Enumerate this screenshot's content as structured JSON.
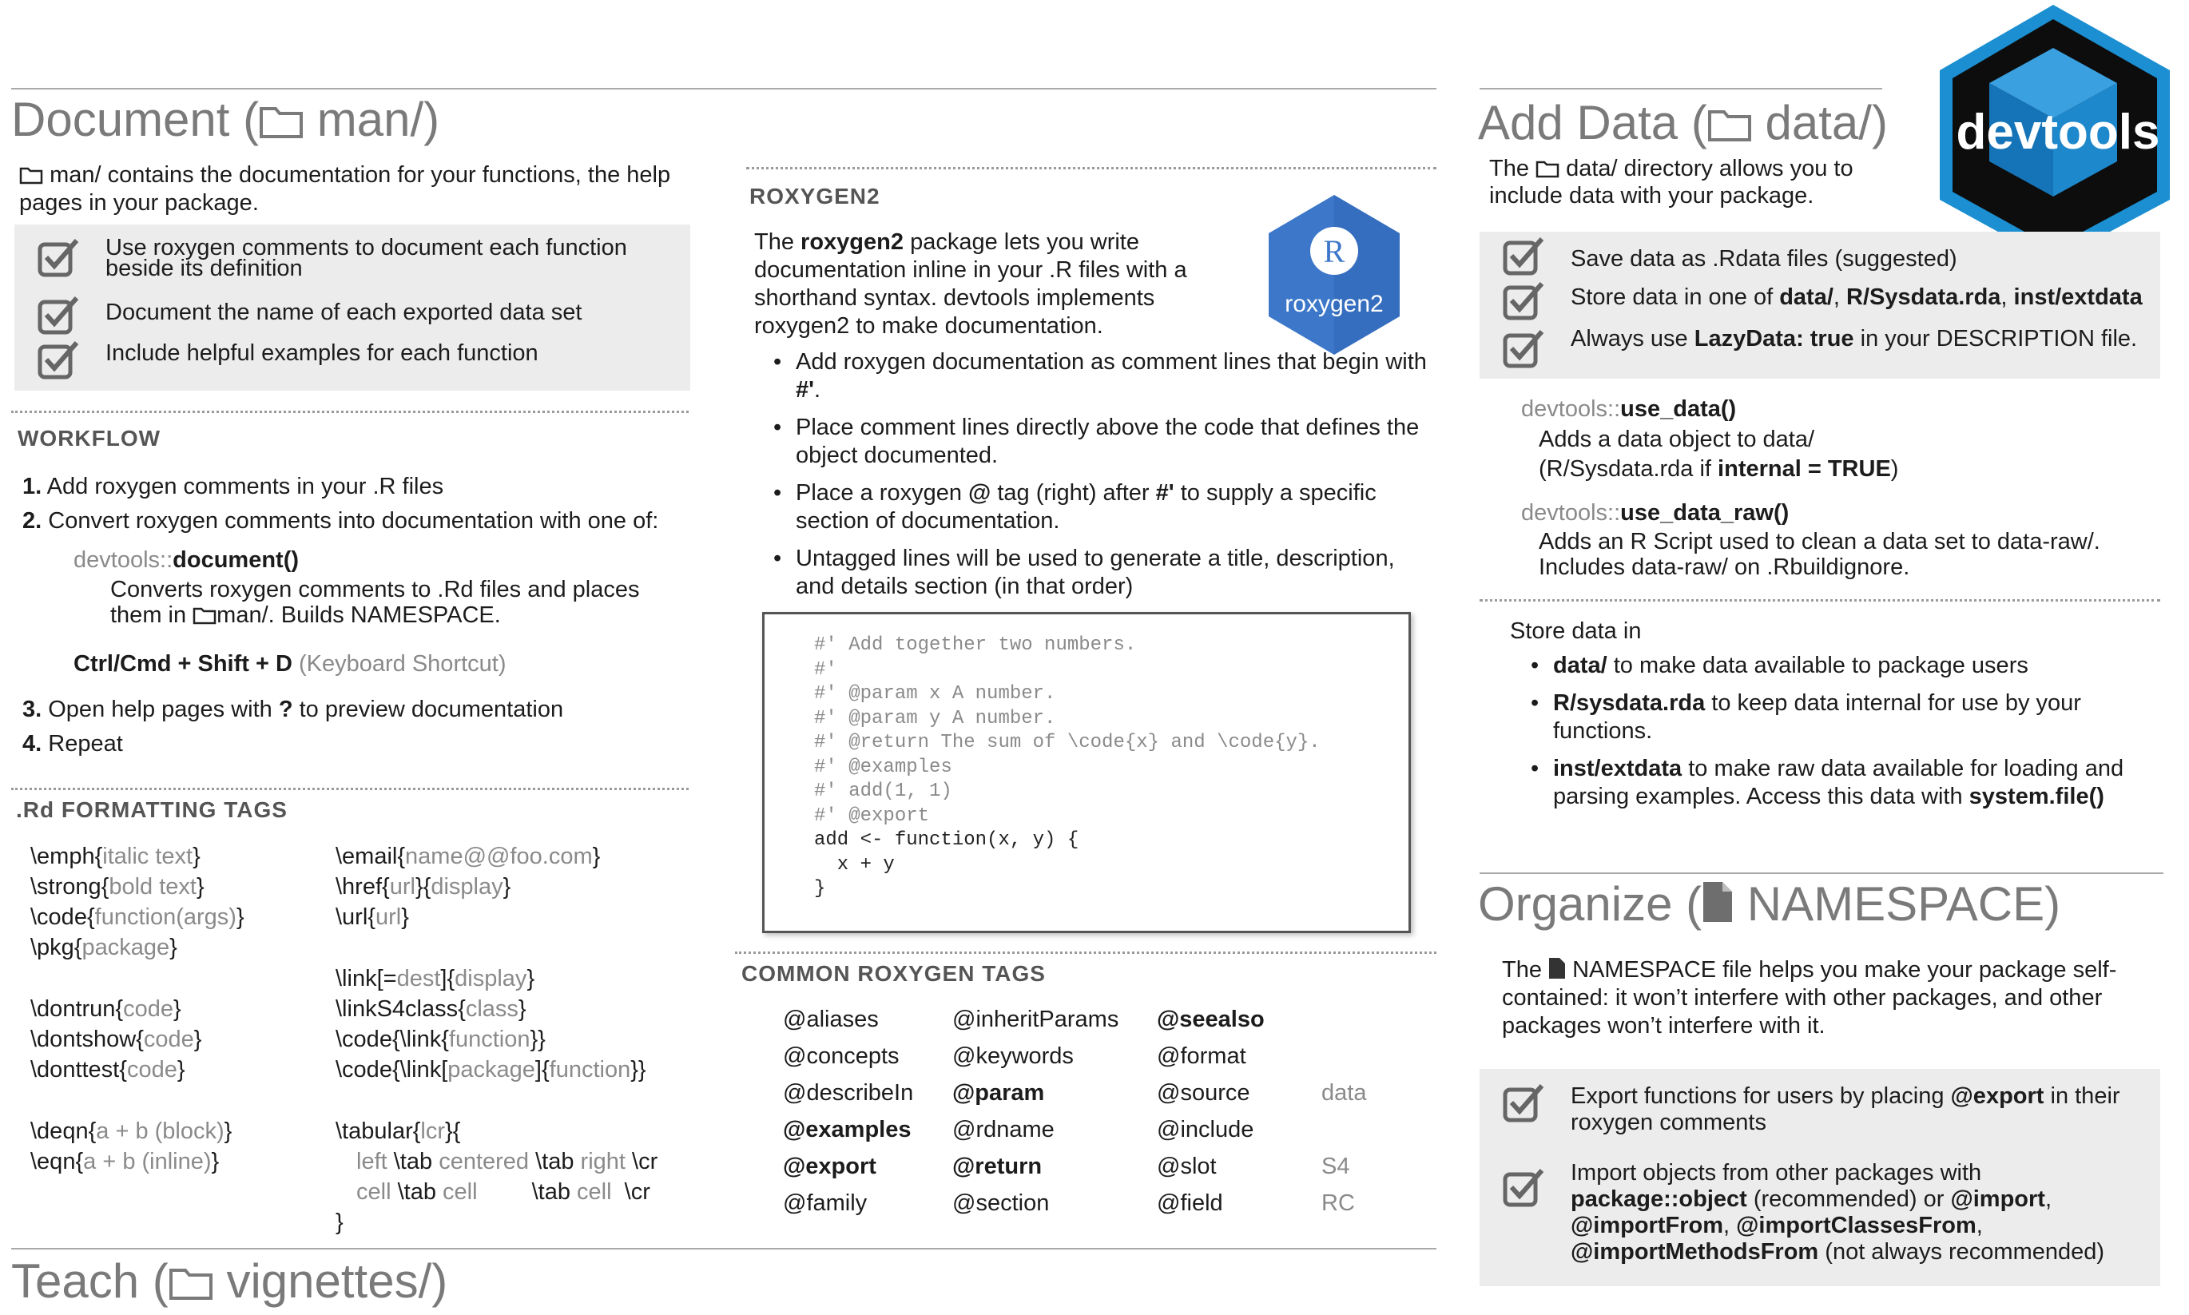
{
  "document": {
    "heading_word": "Document",
    "heading_dir": "man/)",
    "intro_dir": "man/",
    "intro_text": "contains the documentation for your functions, the help pages in your package.",
    "checks": [
      "Use roxygen comments to document each function beside its definition",
      "Document the name of each exported data set",
      "Include helpful examples for each function"
    ],
    "workflow": {
      "title": "WORKFLOW",
      "step1_num": "1.",
      "step1": "Add roxygen comments in your .R files",
      "step2_num": "2.",
      "step2": "Convert roxygen comments into documentation with one of:",
      "fn_prefix": "devtools::",
      "fn_name": "document()",
      "fn_desc_1": "Converts roxygen comments to .Rd files and places",
      "fn_desc_2_pre": "them in",
      "fn_desc_2_dir": "man/. Builds NAMESPACE.",
      "shortcut": "Ctrl/Cmd + Shift + D",
      "shortcut_note": "(Keyboard Shortcut)",
      "step3_num": "3.",
      "step3_pre": "Open help pages with",
      "step3_q": "?",
      "step3_post": "to preview documentation",
      "step4_num": "4.",
      "step4": "Repeat"
    },
    "rd_tags_title": ".Rd FORMATTING TAGS"
  },
  "rd_tags": {
    "col1": [
      [
        "\\emph{",
        "italic text",
        "}"
      ],
      [
        "\\strong{",
        "bold text",
        "}"
      ],
      [
        "\\code{",
        "function(args)",
        "}"
      ],
      [
        "\\pkg{",
        "package",
        "}"
      ],
      [
        "\\dontrun{",
        "code",
        "}"
      ],
      [
        "\\dontshow{",
        "code",
        "}"
      ],
      [
        "\\donttest{",
        "code",
        "}"
      ],
      [
        "\\deqn{",
        "a + b (block)",
        "}"
      ],
      [
        "\\eqn{",
        "a + b (inline)",
        "}"
      ]
    ],
    "col2": [
      [
        "\\email{",
        "name@@foo.com",
        "}"
      ],
      [
        "\\href{",
        "url",
        "}{",
        "display",
        "}"
      ],
      [
        "\\url{",
        "url",
        "}"
      ],
      [
        "\\link[=",
        "dest",
        "]{",
        "display",
        "}"
      ],
      [
        "\\linkS4class{",
        "class",
        "}"
      ],
      [
        "\\code{\\link{",
        "function",
        "}}"
      ],
      [
        "\\code{\\link[",
        "package",
        "]{",
        "function",
        "}}"
      ],
      [
        "\\tabular{",
        "lcr",
        "}{"
      ]
    ],
    "tabular_rows": [
      [
        "left",
        "\\tab",
        "centered",
        "\\tab",
        "right",
        "\\cr"
      ],
      [
        "cell",
        "\\tab",
        "cell",
        "\\tab",
        "cell",
        "\\cr"
      ]
    ],
    "tabular_close": "}"
  },
  "roxygen": {
    "title": "ROXYGEN2",
    "intro_1": "The",
    "intro_pkg": "roxygen2",
    "intro_2": "package lets you write documentation inline in your .R files with a shorthand syntax. devtools implements roxygen2 to make documentation.",
    "logo_r": "R",
    "logo_text": "roxygen2",
    "bullets": [
      {
        "pre": "Add roxygen documentation as comment lines that begin with",
        "b": "#'",
        "post": "."
      },
      {
        "pre": "Place comment lines directly above the code that defines the object documented.",
        "b": "",
        "post": ""
      },
      {
        "pre": "Place a roxygen",
        "b": "@",
        "post": "tag (right) after",
        "b2": "#'",
        "post2": "to supply a specific section of documentation."
      },
      {
        "pre": "Untagged lines will be used to generate a title, description, and details section (in that order)",
        "b": "",
        "post": ""
      }
    ],
    "code_comments": [
      "#' Add together two numbers.",
      "#'",
      "#' @param x A number.",
      "#' @param y A number.",
      "#' @return The sum of \\code{x} and \\code{y}.",
      "#' @examples",
      "#' add(1, 1)",
      "#' @export"
    ],
    "code_lines": [
      "add <- function(x, y) {",
      "  x + y",
      "}"
    ]
  },
  "common_tags": {
    "title": "COMMON ROXYGEN TAGS",
    "col1": [
      "@aliases",
      "@concepts",
      "@describeIn",
      "@examples",
      "@export",
      "@family"
    ],
    "col1_bold": [
      false,
      false,
      false,
      true,
      true,
      false
    ],
    "col2": [
      "@inheritParams",
      "@keywords",
      "@param",
      "@rdname",
      "@return",
      "@section"
    ],
    "col2_bold": [
      false,
      false,
      true,
      false,
      true,
      false
    ],
    "col3": [
      "@seealso",
      "@format",
      "@source",
      "@include",
      "@slot",
      "@field"
    ],
    "col3_bold": [
      true,
      false,
      false,
      false,
      false,
      false
    ],
    "col4": [
      "",
      "",
      "data",
      "",
      "S4",
      "RC"
    ]
  },
  "teach": {
    "heading_word": "Teach",
    "heading_dir": "vignettes/)"
  },
  "add_data": {
    "heading_word": "Add Data",
    "heading_dir": "data/)",
    "intro_pre": "The",
    "intro_dir": "data/",
    "intro_post": "directory allows you to include data with your package.",
    "checks": [
      {
        "parts": [
          "Save data as .Rdata files (suggested)"
        ]
      },
      {
        "parts": [
          "Store data in one of ",
          "data/",
          ", ",
          "R/Sysdata.rda",
          ", ",
          "inst/extdata"
        ]
      },
      {
        "parts": [
          "Always use ",
          "LazyData: true",
          " in your DESCRIPTION file."
        ]
      }
    ],
    "fn1_prefix": "devtools::",
    "fn1_name": "use_data()",
    "fn1_desc_1": "Adds a data object to data/",
    "fn1_desc_2_pre": "(R/Sysdata.rda if",
    "fn1_desc_2_b": "internal = TRUE",
    "fn1_desc_2_post": ")",
    "fn2_prefix": "devtools::",
    "fn2_name": "use_data_raw()",
    "fn2_desc_1": "Adds an R Script used to clean a data set to data-raw/.",
    "fn2_desc_2": "Includes data-raw/ on .Rbuildignore.",
    "store_title": "Store data in",
    "store_items": [
      {
        "b": "data/",
        "t": "to make data available to package users"
      },
      {
        "b": "R/sysdata.rda",
        "t": "to keep data internal for use by your functions."
      },
      {
        "b": "inst/extdata",
        "t": "to make raw data available for loading and parsing examples. Access this data with",
        "b2": "system.file()"
      }
    ]
  },
  "devtools_logo": {
    "text": "devtools",
    "fg": "#ffffff",
    "bg": "#1b8fd1"
  },
  "organize": {
    "heading_word": "Organize",
    "heading_dir": "NAMESPACE)",
    "intro_pre": "The",
    "intro_post": "NAMESPACE file helps you make your package self-contained: it won’t interfere with other packages, and other packages won’t interfere with it.",
    "check1_pre": "Export functions for users by placing",
    "check1_b": "@export",
    "check1_post": "in their roxygen comments",
    "check2_pre": "Import objects from other packages with",
    "check2_b1": "package::object",
    "check2_m1": "(recommended) or",
    "check2_b2": "@import",
    "check2_b3": "@importFrom",
    "check2_b4": "@importClassesFrom",
    "check2_b5": "@importMethodsFrom",
    "check2_m2": "(not always recommended)"
  }
}
